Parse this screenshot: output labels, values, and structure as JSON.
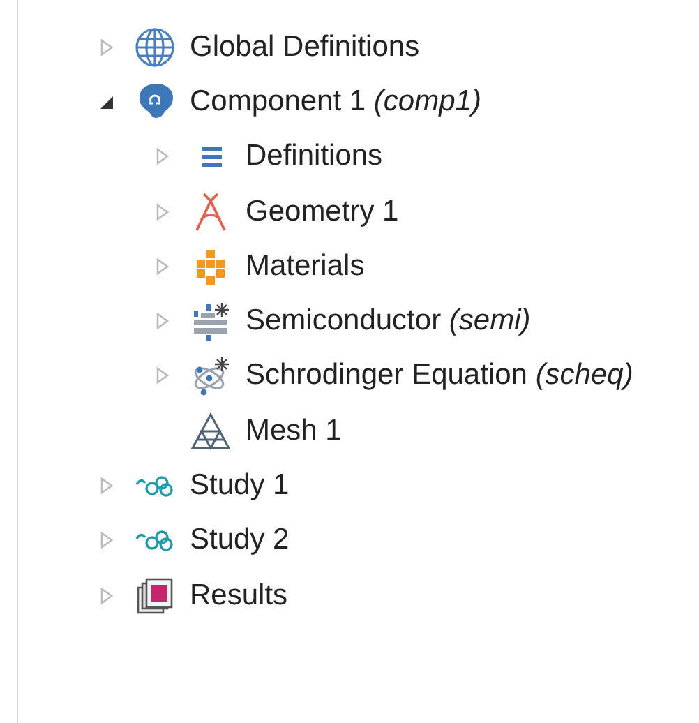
{
  "tree": [
    {
      "label": "Global Definitions",
      "kind": "globe",
      "expanded": false
    },
    {
      "label": "Component 1 *(comp1)*",
      "kind": "component",
      "expanded": true,
      "children": [
        {
          "label": "Definitions",
          "kind": "definitions",
          "expanded": false
        },
        {
          "label": "Geometry 1",
          "kind": "geometry",
          "expanded": false
        },
        {
          "label": "Materials",
          "kind": "materials",
          "expanded": false
        },
        {
          "label": "Semiconductor *(semi)*",
          "kind": "semiconductor",
          "expanded": false
        },
        {
          "label": "Schrodinger Equation *(scheq)*",
          "kind": "schrodinger",
          "expanded": false
        },
        {
          "label": "Mesh 1",
          "kind": "mesh"
        }
      ]
    },
    {
      "label": "Study 1",
      "kind": "study",
      "expanded": false
    },
    {
      "label": "Study 2",
      "kind": "study",
      "expanded": false
    },
    {
      "label": "Results",
      "kind": "results",
      "expanded": false
    }
  ]
}
